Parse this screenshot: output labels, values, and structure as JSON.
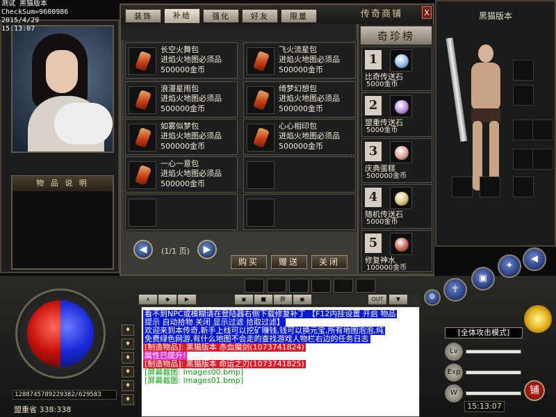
{
  "debug": {
    "line1": "测试 黑猫版本",
    "line2": "CheckSum=9600986",
    "line3": "2015/4/29",
    "line4": "15:13:07"
  },
  "left_panel": {
    "desc_title": "物 品 说 明"
  },
  "shop": {
    "tabs": [
      {
        "label": "装饰",
        "active": false
      },
      {
        "label": "补给",
        "active": true
      },
      {
        "label": "强化",
        "active": false
      },
      {
        "label": "好友",
        "active": false
      },
      {
        "label": "限量",
        "active": false
      }
    ],
    "title": "传奇商铺",
    "close_label": "X",
    "items": [
      {
        "name": "长空火舞包",
        "note": "进焰火地图必须品",
        "price": "500000金币"
      },
      {
        "name": "飞火流星包",
        "note": "进焰火地图必须品",
        "price": "500000金币"
      },
      {
        "name": "浪漫星雨包",
        "note": "进焰火地图必须品",
        "price": "500000金币"
      },
      {
        "name": "绮梦幻想包",
        "note": "进焰火地图必须品",
        "price": "500000金币"
      },
      {
        "name": "如雾似梦包",
        "note": "进焰火地图必须品",
        "price": "500000金币"
      },
      {
        "name": "心心相印包",
        "note": "进焰火地图必须品",
        "price": "500000金币"
      },
      {
        "name": "一心一意包",
        "note": "进焰火地图必须品",
        "price": "500000金币"
      }
    ],
    "pager": {
      "prev": "◀",
      "next": "▶",
      "text": "(1/1 页)"
    },
    "buttons": {
      "buy": "购买",
      "gift": "赠送",
      "close": "关闭"
    },
    "rare_title": "奇珍榜",
    "rare": [
      {
        "num": "1",
        "name": "比奇传送石",
        "price": "5000金币",
        "color": "#8fb8e8"
      },
      {
        "num": "2",
        "name": "盟重传送石",
        "price": "5000金币",
        "color": "#b58ee0"
      },
      {
        "num": "3",
        "name": "庆典蛋糕",
        "price": "500000金币",
        "color": "#e0a090"
      },
      {
        "num": "4",
        "name": "随机传送石",
        "price": "5000金币",
        "color": "#d8c070"
      },
      {
        "num": "5",
        "name": "修复神水",
        "price": "100000金币",
        "color": "#c86050"
      }
    ]
  },
  "equipment": {
    "title": "黑猫版本"
  },
  "bottom": {
    "hp_text": "1288745789229382/629583",
    "location": "盟重省  338:338",
    "chat_toolbar": [
      "∧",
      "◆",
      "▶",
      "▣",
      "■",
      "群",
      "▣",
      "OUT",
      "▼"
    ],
    "chat_lines": [
      {
        "text": "看不到NPC或模糊请在登陆器右侧下载修复补丁 【F12内挂设置 开启 物品",
        "color": "#ffffff",
        "bg": "#0b1bd0"
      },
      {
        "text": "提示 自动拾物 关闭 显示过滤 拾取过滤】",
        "color": "#ffffff",
        "bg": "#0b1bd0"
      },
      {
        "text": "欢迎来到本传奇,新手上线可以挖矿赚钱,钱可以换元宝,所有地图泡泡,纯",
        "color": "#ffffff",
        "bg": "#0b1bd0"
      },
      {
        "text": "免费绿色网游,有什么地图不会走的查找游戏人物栏右边的任务日志",
        "color": "#ffffff",
        "bg": "#0b1bd0"
      },
      {
        "text": "[制造物品]: 黑猫版本  赤血魔剑(1073741824)",
        "color": "#ffffff",
        "bg": "#d81c2a"
      },
      {
        "text": "属性已提升!",
        "color": "#ffffff",
        "bg": "#e030d0"
      },
      {
        "text": "[制造物品]: 黑猫版本  命运之刃(1073741825)",
        "color": "#ffffff",
        "bg": "#d81c2a"
      },
      {
        "text": "[屏幕截图: Images00.bmp]",
        "color": "#0aa00a",
        "bg": "#ffffff"
      },
      {
        "text": "[屏幕截图: Images01.bmp]",
        "color": "#0aa00a",
        "bg": "#ffffff"
      }
    ],
    "attack_mode": "[全体攻击模式]",
    "clock": "15:13:07",
    "shop_btn": "铺",
    "hud_labels": [
      "Lv",
      "Exp",
      "W"
    ]
  }
}
